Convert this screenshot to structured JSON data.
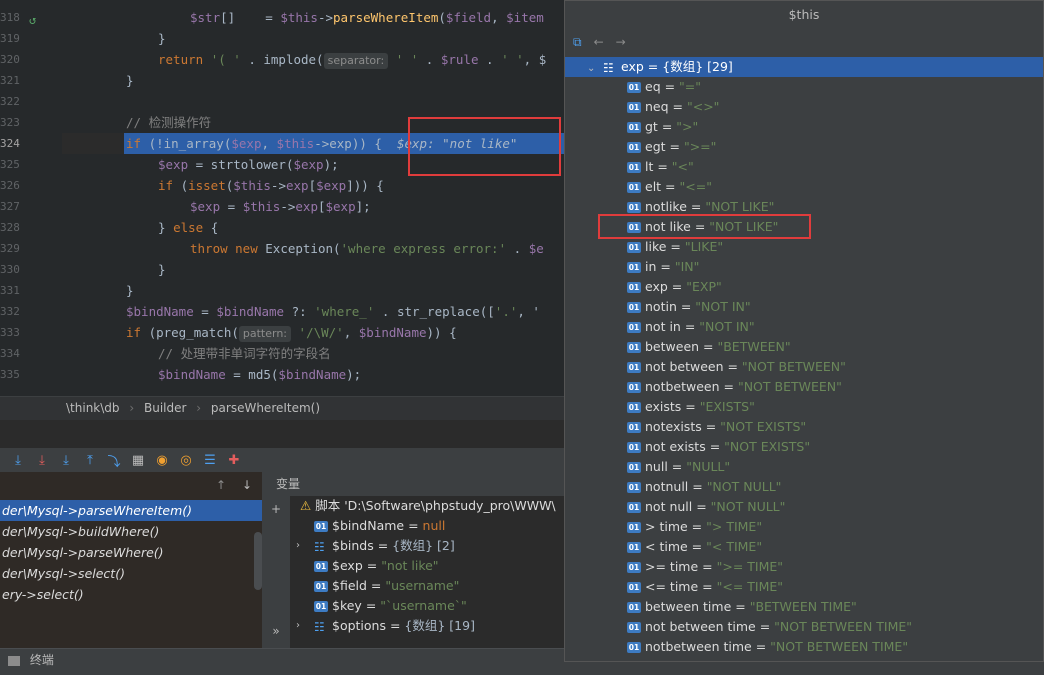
{
  "editor": {
    "lines": [
      {
        "num": "318",
        "indent": 2,
        "tokens": [
          [
            "var",
            "$str"
          ],
          [
            "plain",
            "[]    = "
          ],
          [
            "var",
            "$this"
          ],
          [
            "plain",
            "->"
          ],
          [
            "fn",
            "parseWhereItem"
          ],
          [
            "plain",
            "("
          ],
          [
            "var",
            "$field"
          ],
          [
            "plain",
            ", "
          ],
          [
            "var",
            "$item"
          ]
        ]
      },
      {
        "num": "319",
        "indent": 1,
        "tokens": [
          [
            "plain",
            "}"
          ]
        ]
      },
      {
        "num": "320",
        "indent": 1,
        "tokens": [
          [
            "kw",
            "return "
          ],
          [
            "str",
            "'( '"
          ],
          [
            "plain",
            " . implode("
          ]
        ],
        "hint": "separator:",
        "tail": [
          [
            "str",
            " ' '"
          ],
          [
            "plain",
            " . "
          ],
          [
            "var",
            "$rule"
          ],
          [
            "plain",
            " . "
          ],
          [
            "str",
            "' '"
          ],
          [
            "plain",
            ", $"
          ]
        ]
      },
      {
        "num": "321",
        "indent": 0,
        "tokens": [
          [
            "plain",
            "}"
          ]
        ]
      },
      {
        "num": "322",
        "indent": 0,
        "tokens": []
      },
      {
        "num": "323",
        "indent": 0,
        "tokens": [
          [
            "cmp",
            "// 检测操作符"
          ]
        ]
      },
      {
        "num": "324",
        "indent": 0,
        "current": true,
        "tokens": [
          [
            "kw",
            "if "
          ],
          [
            "plain",
            "(!in_array("
          ],
          [
            "var",
            "$exp"
          ],
          [
            "plain",
            ", "
          ],
          [
            "var",
            "$this"
          ],
          [
            "plain",
            "->exp)) {  "
          ]
        ],
        "inline": "$exp: \"not like\""
      },
      {
        "num": "325",
        "indent": 1,
        "tokens": [
          [
            "var",
            "$exp"
          ],
          [
            "plain",
            " = strtolower("
          ],
          [
            "var",
            "$exp"
          ],
          [
            "plain",
            ");"
          ]
        ]
      },
      {
        "num": "326",
        "indent": 1,
        "tokens": [
          [
            "kw",
            "if "
          ],
          [
            "plain",
            "("
          ],
          [
            "kw",
            "isset"
          ],
          [
            "plain",
            "("
          ],
          [
            "var",
            "$this"
          ],
          [
            "plain",
            "->"
          ],
          [
            "var",
            "exp"
          ],
          [
            "plain",
            "["
          ],
          [
            "var",
            "$exp"
          ],
          [
            "plain",
            "])) {"
          ]
        ]
      },
      {
        "num": "327",
        "indent": 2,
        "tokens": [
          [
            "var",
            "$exp"
          ],
          [
            "plain",
            " = "
          ],
          [
            "var",
            "$this"
          ],
          [
            "plain",
            "->"
          ],
          [
            "var",
            "exp"
          ],
          [
            "plain",
            "["
          ],
          [
            "var",
            "$exp"
          ],
          [
            "plain",
            "];"
          ]
        ]
      },
      {
        "num": "328",
        "indent": 1,
        "tokens": [
          [
            "plain",
            "} "
          ],
          [
            "kw",
            "else "
          ],
          [
            "plain",
            "{"
          ]
        ]
      },
      {
        "num": "329",
        "indent": 2,
        "tokens": [
          [
            "kw",
            "throw new "
          ],
          [
            "plain",
            "Exception("
          ],
          [
            "str",
            "'where express error:'"
          ],
          [
            "plain",
            " . "
          ],
          [
            "var",
            "$e"
          ]
        ]
      },
      {
        "num": "330",
        "indent": 1,
        "tokens": [
          [
            "plain",
            "}"
          ]
        ]
      },
      {
        "num": "331",
        "indent": 0,
        "tokens": [
          [
            "plain",
            "}"
          ]
        ]
      },
      {
        "num": "332",
        "indent": 0,
        "tokens": [
          [
            "var",
            "$bindName"
          ],
          [
            "plain",
            " = "
          ],
          [
            "var",
            "$bindName"
          ],
          [
            "plain",
            " ?: "
          ],
          [
            "str",
            "'where_'"
          ],
          [
            "plain",
            " . str_replace(["
          ],
          [
            "str",
            "'.'"
          ],
          [
            "plain",
            ", '"
          ]
        ]
      },
      {
        "num": "333",
        "indent": 0,
        "tokens": [
          [
            "kw",
            "if "
          ],
          [
            "plain",
            "(preg_match("
          ]
        ],
        "hint": "pattern:",
        "tail": [
          [
            "str",
            " '/\\W/'"
          ],
          [
            "plain",
            ", "
          ],
          [
            "var",
            "$bindName"
          ],
          [
            "plain",
            ")) {"
          ]
        ]
      },
      {
        "num": "334",
        "indent": 1,
        "tokens": [
          [
            "cmp",
            "// 处理带非单词字符的字段名"
          ]
        ]
      },
      {
        "num": "335",
        "indent": 1,
        "tokens": [
          [
            "var",
            "$bindName"
          ],
          [
            "plain",
            " = md5("
          ],
          [
            "var",
            "$bindName"
          ],
          [
            "plain",
            ");"
          ]
        ]
      }
    ]
  },
  "breadcrumb": {
    "items": [
      "\\think\\db",
      "Builder",
      "parseWhereItem()"
    ]
  },
  "frames": {
    "items": [
      {
        "label": "der\\Mysql->parseWhereItem()",
        "selected": true
      },
      {
        "label": "der\\Mysql->buildWhere()",
        "selected": false
      },
      {
        "label": "der\\Mysql->parseWhere()",
        "selected": false
      },
      {
        "label": "der\\Mysql->select()",
        "selected": false
      },
      {
        "label": "ery->select()",
        "selected": false
      }
    ]
  },
  "variables": {
    "title": "变量",
    "rows": [
      {
        "kind": "warn",
        "name": "脚本 'D:\\Software\\phpstudy_pro\\WWW\\",
        "value": ""
      },
      {
        "kind": "var",
        "name": "$bindName",
        "eq": " = ",
        "value": "null",
        "plain": true
      },
      {
        "kind": "arr",
        "name": "$binds",
        "eq": " = ",
        "type": "{数组} [2]"
      },
      {
        "kind": "var",
        "name": "$exp",
        "eq": " = ",
        "value": "\"not like\""
      },
      {
        "kind": "var",
        "name": "$field",
        "eq": " = ",
        "value": "\"username\""
      },
      {
        "kind": "var",
        "name": "$key",
        "eq": " = ",
        "value": "\"`username`\""
      },
      {
        "kind": "arr",
        "name": "$options",
        "eq": " = ",
        "type": "{数组} [19]"
      }
    ]
  },
  "statusbar": {
    "terminal_label": "终端"
  },
  "popup": {
    "title": "$this",
    "head": {
      "name": "exp",
      "type": "= {数组} [29]"
    },
    "entries": [
      {
        "k": "eq",
        "v": "\"=\""
      },
      {
        "k": "neq",
        "v": "\"<>\""
      },
      {
        "k": "gt",
        "v": "\">\""
      },
      {
        "k": "egt",
        "v": "\">=\""
      },
      {
        "k": "lt",
        "v": "\"<\""
      },
      {
        "k": "elt",
        "v": "\"<=\""
      },
      {
        "k": "notlike",
        "v": "\"NOT LIKE\""
      },
      {
        "k": "not like",
        "v": "\"NOT LIKE\""
      },
      {
        "k": "like",
        "v": "\"LIKE\""
      },
      {
        "k": "in",
        "v": "\"IN\""
      },
      {
        "k": "exp",
        "v": "\"EXP\""
      },
      {
        "k": "notin",
        "v": "\"NOT IN\""
      },
      {
        "k": "not in",
        "v": "\"NOT IN\""
      },
      {
        "k": "between",
        "v": "\"BETWEEN\""
      },
      {
        "k": "not between",
        "v": "\"NOT BETWEEN\""
      },
      {
        "k": "notbetween",
        "v": "\"NOT BETWEEN\""
      },
      {
        "k": "exists",
        "v": "\"EXISTS\""
      },
      {
        "k": "notexists",
        "v": "\"NOT EXISTS\""
      },
      {
        "k": "not exists",
        "v": "\"NOT EXISTS\""
      },
      {
        "k": "null",
        "v": "\"NULL\""
      },
      {
        "k": "notnull",
        "v": "\"NOT NULL\""
      },
      {
        "k": "not null",
        "v": "\"NOT NULL\""
      },
      {
        "k": "> time",
        "v": "\"> TIME\""
      },
      {
        "k": "< time",
        "v": "\"< TIME\""
      },
      {
        "k": ">= time",
        "v": "\">= TIME\""
      },
      {
        "k": "<= time",
        "v": "\"<= TIME\""
      },
      {
        "k": "between time",
        "v": "\"BETWEEN TIME\""
      },
      {
        "k": "not between time",
        "v": "\"NOT BETWEEN TIME\""
      },
      {
        "k": "notbetween time",
        "v": "\"NOT BETWEEN TIME\""
      }
    ]
  },
  "colors": {
    "accent": "#2d5fa8",
    "highlight_box": "#e03c3c",
    "string": "#6a8759"
  }
}
